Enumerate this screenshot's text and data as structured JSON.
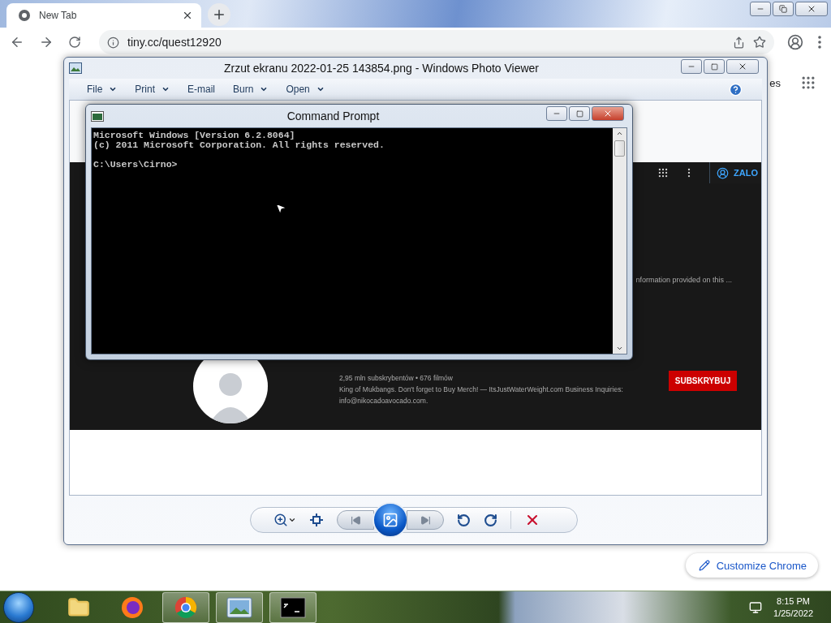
{
  "browser": {
    "tabs": [
      {
        "title": "New Tab",
        "selected": true
      }
    ],
    "address": "tiny.cc/quest12920",
    "ntp_link": "es",
    "customize_button": "Customize Chrome"
  },
  "photo_viewer": {
    "title": "Zrzut ekranu 2022-01-25 143854.png - Windows Photo Viewer",
    "menu": [
      {
        "label": "File",
        "dropdown": true
      },
      {
        "label": "Print",
        "dropdown": true
      },
      {
        "label": "E-mail",
        "dropdown": false
      },
      {
        "label": "Burn",
        "dropdown": true
      },
      {
        "label": "Open",
        "dropdown": true
      }
    ],
    "image": {
      "account_button": "ZALO",
      "description_fragment": "nformation provided on this ...",
      "channel_stats": "2,95 mln subskrybentów • 676 filmów",
      "channel_description": "King of Mukbangs. Don't forget to Buy Merch! — ItsJustWaterWeight.com Business Inquiries:",
      "channel_email": "info@nikocadoavocado.com.",
      "subscribe_button": "SUBSKRYBUJ"
    }
  },
  "command_prompt": {
    "title": "Command Prompt",
    "lines": [
      {
        "kind": "output",
        "text": "Microsoft Windows [Version 6.2.8064]"
      },
      {
        "kind": "output",
        "text": "(c) 2011 Microsoft Corporation. All rights reserved."
      },
      {
        "kind": "prompt",
        "text": "C:\\Users\\Cirno>"
      }
    ]
  },
  "taskbar": {
    "apps": [
      {
        "kind": "explorer",
        "running": false
      },
      {
        "kind": "firefox",
        "running": false
      },
      {
        "kind": "chrome",
        "running": true
      },
      {
        "kind": "photos",
        "running": true
      },
      {
        "kind": "console",
        "running": true
      }
    ],
    "time": "8:15 PM",
    "date": "1/25/2022"
  }
}
